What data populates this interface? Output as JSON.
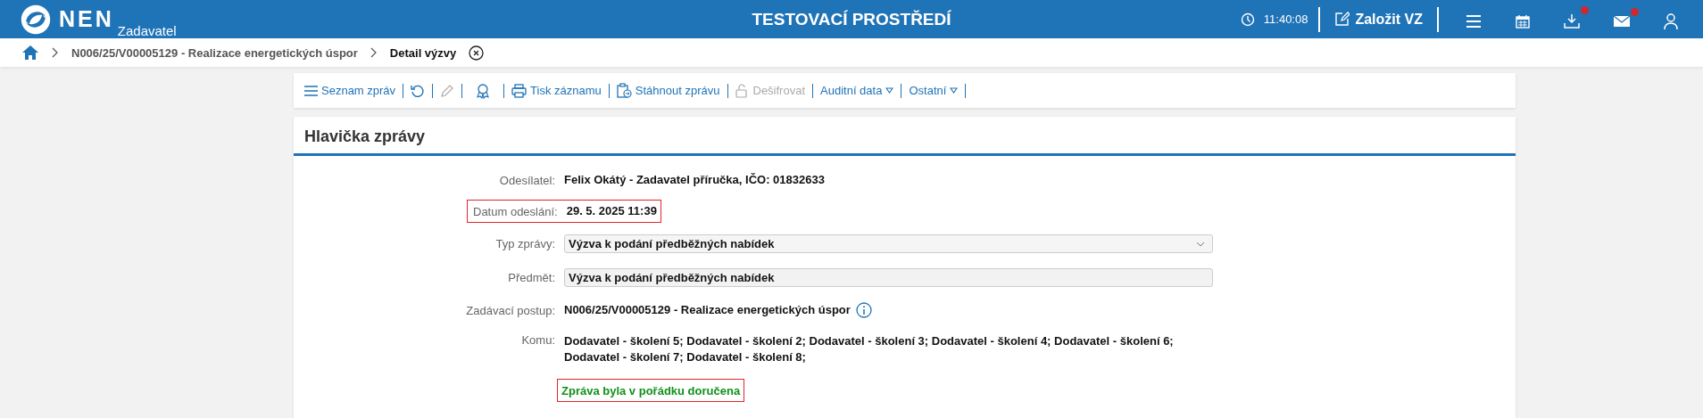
{
  "header": {
    "logo": "NEN",
    "role": "Zadavatel",
    "environment": "TESTOVACÍ PROSTŘEDÍ",
    "time": "11:40:08",
    "create_button": "Založit VZ",
    "notifications": [
      {
        "kind": "menu",
        "badge": false
      },
      {
        "kind": "calendar",
        "badge": false
      },
      {
        "kind": "download",
        "badge": true
      },
      {
        "kind": "mail",
        "badge": true
      },
      {
        "kind": "user",
        "badge": false
      }
    ]
  },
  "breadcrumb": [
    {
      "label": "N006/25/V00005129 - Realizace energetických úspor",
      "current": false
    },
    {
      "label": "Detail výzvy",
      "current": true
    }
  ],
  "toolbar": [
    {
      "kind": "list",
      "label": "Seznam zpráv",
      "disabled": false
    },
    {
      "kind": "refresh",
      "disabled": false
    },
    {
      "kind": "edit",
      "disabled": true
    },
    {
      "kind": "award",
      "disabled": false
    },
    {
      "kind": "print",
      "label": "Tisk záznamu",
      "disabled": false
    },
    {
      "kind": "download",
      "label": "Stáhnout zprávu",
      "disabled": false
    },
    {
      "kind": "unlock",
      "label": "Dešifrovat",
      "disabled": true
    },
    {
      "kind": "dropdown",
      "label": "Auditní data",
      "disabled": false
    },
    {
      "kind": "dropdown",
      "label": "Ostatní",
      "disabled": false
    }
  ],
  "panel": {
    "title": "Hlavička zprávy",
    "fields": [
      {
        "kind": "text",
        "label": "Odesílatel:",
        "value": "Felix Okátý - Zadavatel příručka, IČO: 01832633",
        "highlighted": false
      },
      {
        "kind": "text",
        "label": "Datum odeslání:",
        "value": "29. 5. 2025 11:39",
        "highlighted": true
      },
      {
        "kind": "select",
        "label": "Typ zprávy:",
        "value": "Výzva k podání předběžných nabídek",
        "highlighted": false
      },
      {
        "kind": "input",
        "label": "Předmět:",
        "value": "Výzva k podání předběžných nabídek",
        "highlighted": false
      },
      {
        "kind": "info",
        "label": "Zadávací postup:",
        "value": "N006/25/V00005129 - Realizace energetických úspor",
        "highlighted": false
      },
      {
        "kind": "text",
        "label": "Komu:",
        "value": "Dodavatel - školení 5; Dodavatel - školení 2; Dodavatel - školení 3; Dodavatel - školení 4; Dodavatel - školení 6; Dodavatel - školení 7; Dodavatel - školení 8;",
        "highlighted": false
      },
      {
        "kind": "status",
        "value": "Zpráva byla v pořádku doručena",
        "highlighted": true
      }
    ]
  }
}
